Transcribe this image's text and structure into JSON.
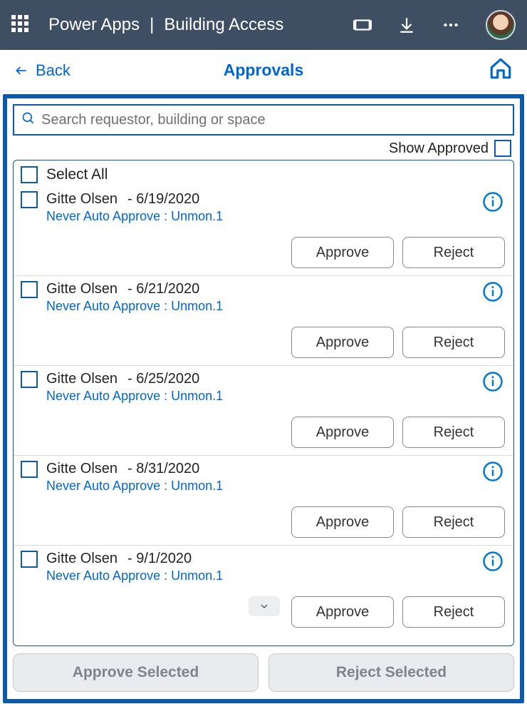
{
  "header": {
    "app_name": "Power Apps",
    "page_name": "Building Access"
  },
  "nav": {
    "back_label": "Back",
    "title": "Approvals"
  },
  "search": {
    "placeholder": "Search requestor, building or space",
    "value": ""
  },
  "show_approved_label": "Show Approved",
  "select_all_label": "Select All",
  "buttons": {
    "approve": "Approve",
    "reject": "Reject",
    "approve_selected": "Approve Selected",
    "reject_selected": "Reject Selected"
  },
  "requests": [
    {
      "name": "Gitte Olsen",
      "date": "- 6/19/2020",
      "detail": "Never Auto Approve : Unmon.1",
      "show_chevron": false
    },
    {
      "name": "Gitte Olsen",
      "date": "- 6/21/2020",
      "detail": "Never Auto Approve : Unmon.1",
      "show_chevron": false
    },
    {
      "name": "Gitte Olsen",
      "date": "- 6/25/2020",
      "detail": "Never Auto Approve : Unmon.1",
      "show_chevron": false
    },
    {
      "name": "Gitte Olsen",
      "date": "- 8/31/2020",
      "detail": "Never Auto Approve : Unmon.1",
      "show_chevron": false
    },
    {
      "name": "Gitte Olsen",
      "date": "- 9/1/2020",
      "detail": "Never Auto Approve : Unmon.1",
      "show_chevron": true
    }
  ]
}
